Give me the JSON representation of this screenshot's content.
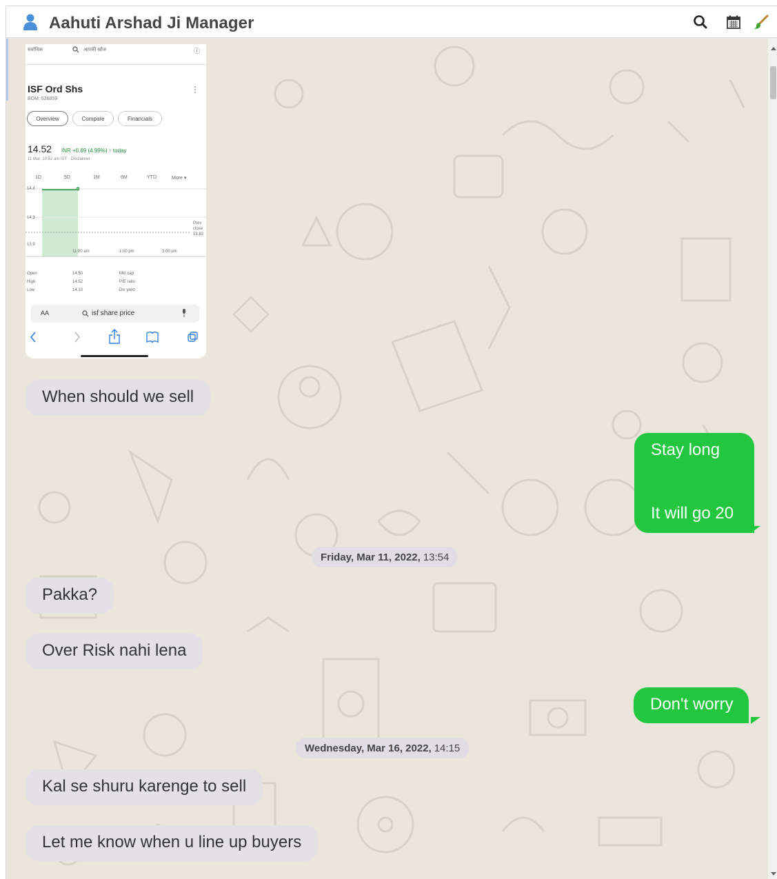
{
  "header": {
    "contact_name": "Aahuti Arshad Ji Manager",
    "icons": [
      "person-icon",
      "search-icon",
      "calendar-icon",
      "brush-icon"
    ]
  },
  "attachment": {
    "top_search_placeholder": "आपकी खोज",
    "stock_title": "ISF Ord Shs",
    "stock_exchange": "BOM: 526859",
    "tabs": [
      "Overview",
      "Compare",
      "Financials"
    ],
    "price": "14.52",
    "price_change": "INR +0.69 (4.99%) ↑ today",
    "price_date": "11 Mar, 10:52 am IST · Disclaimer",
    "ranges": [
      "1D",
      "5D",
      "1M",
      "6M",
      "YTD",
      "More ▾"
    ],
    "y_ticks": [
      "14.4",
      "14.3",
      "13.9"
    ],
    "x_ticks": [
      "11:00 am",
      "1:00 pm",
      "3:00 pm"
    ],
    "prev_close": [
      "Prev",
      "close",
      "13.83"
    ],
    "stats_left": [
      [
        "Open",
        "14.50"
      ],
      [
        "High",
        "14.52"
      ],
      [
        "Low",
        "14.10"
      ]
    ],
    "stats_right": [
      "Mkt cap",
      "P/E ratio",
      "Div yield"
    ],
    "aa": "AA",
    "search_query": "isf share price"
  },
  "messages": [
    {
      "dir": "in",
      "text": "When should we sell"
    },
    {
      "dir": "out",
      "lines": [
        "Stay long",
        "",
        "It will go 20"
      ]
    },
    {
      "dir": "date",
      "date": "Friday, Mar 11, 2022,",
      "time": "13:54"
    },
    {
      "dir": "in",
      "text": "Pakka?"
    },
    {
      "dir": "in",
      "text": "Over Risk nahi lena"
    },
    {
      "dir": "out",
      "text": "Don't worry"
    },
    {
      "dir": "date",
      "date": "Wednesday, Mar 16, 2022,",
      "time": "14:15"
    },
    {
      "dir": "in",
      "text": "Kal se shuru karenge to sell"
    },
    {
      "dir": "in",
      "text": "Let me know when u line up buyers"
    }
  ],
  "colors": {
    "outgoing": "#22c73f",
    "incoming": "#e3e1e6",
    "background": "#ece5dc"
  }
}
